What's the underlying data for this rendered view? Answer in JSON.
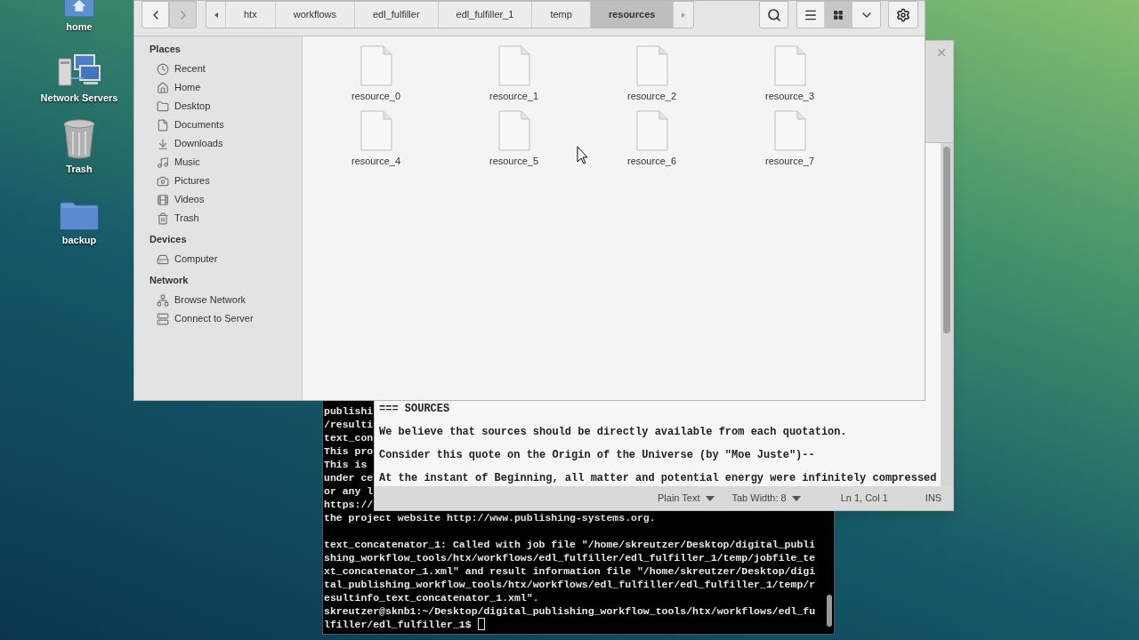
{
  "desktop_icons": [
    {
      "kind": "home",
      "label": "home"
    },
    {
      "kind": "network",
      "label": "Network Servers"
    },
    {
      "kind": "trash",
      "label": "Trash"
    },
    {
      "kind": "folder",
      "label": "backup"
    }
  ],
  "terminal": {
    "blocks": [
      [
        "publishi",
        "/resulti",
        "text_con",
        "This pro",
        "This is ",
        "under ce",
        "or any l",
        "https://",
        "the project website http://www.publishing-systems.org."
      ],
      [
        "text_concatenator_1: Called with job file \"/home/skreutzer/Desktop/digital_publi",
        "shing_workflow_tools/htx/workflows/edl_fulfiller/edl_fulfiller_1/temp/jobfile_te",
        "xt_concatenator_1.xml\" and result information file \"/home/skreutzer/Desktop/digi",
        "tal_publishing_workflow_tools/htx/workflows/edl_fulfiller/edl_fulfiller_1/temp/r",
        "esultinfo_text_concatenator_1.xml\".",
        "skreutzer@sknb1:~/Desktop/digital_publishing_workflow_tools/htx/workflows/edl_fu",
        "lfiller/edl_fulfiller_1$ "
      ]
    ]
  },
  "editor": {
    "lines": [
      "=== SOURCES",
      "We believe that sources should be directly available from each quotation.",
      "Consider this quote on the Origin of the Universe (by \"Moe Juste\")--",
      "At the instant of Beginning, all matter and potential energy were infinitely compressed"
    ],
    "status": {
      "language": "Plain Text",
      "tab_width": "Tab Width: 8",
      "position": "Ln 1, Col 1",
      "mode": "INS"
    }
  },
  "file_manager": {
    "nav": [
      {
        "kind": "back",
        "disabled": false
      },
      {
        "kind": "forward",
        "disabled": true
      }
    ],
    "path": [
      {
        "label": "htx",
        "selected": false
      },
      {
        "label": "workflows",
        "selected": false
      },
      {
        "label": "edl_fulfiller",
        "selected": false
      },
      {
        "label": "edl_fulfiller_1",
        "selected": false
      },
      {
        "label": "temp",
        "selected": false
      },
      {
        "label": "resources",
        "selected": true
      }
    ],
    "view_modes": [
      {
        "kind": "list",
        "selected": false
      },
      {
        "kind": "grid",
        "selected": true
      }
    ],
    "sidebar": [
      {
        "heading": "Places",
        "items": [
          {
            "kind": "recent",
            "label": "Recent"
          },
          {
            "kind": "home",
            "label": "Home"
          },
          {
            "kind": "desktop",
            "label": "Desktop"
          },
          {
            "kind": "documents",
            "label": "Documents"
          },
          {
            "kind": "downloads",
            "label": "Downloads"
          },
          {
            "kind": "music",
            "label": "Music"
          },
          {
            "kind": "pictures",
            "label": "Pictures"
          },
          {
            "kind": "videos",
            "label": "Videos"
          },
          {
            "kind": "trash",
            "label": "Trash"
          }
        ]
      },
      {
        "heading": "Devices",
        "items": [
          {
            "kind": "computer",
            "label": "Computer"
          }
        ]
      },
      {
        "heading": "Network",
        "items": [
          {
            "kind": "network",
            "label": "Browse Network"
          },
          {
            "kind": "server",
            "label": "Connect to Server"
          }
        ]
      }
    ],
    "files": [
      "resource_0",
      "resource_1",
      "resource_2",
      "resource_3",
      "resource_4",
      "resource_5",
      "resource_6",
      "resource_7"
    ]
  }
}
